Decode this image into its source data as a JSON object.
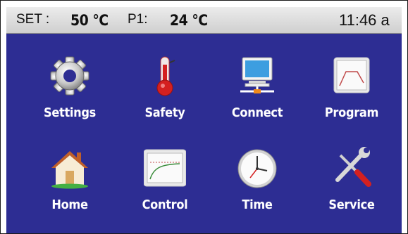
{
  "status": {
    "set_label": "SET :",
    "set_value": "50 °C",
    "p1_label": "P1:",
    "p1_value": "24 °C",
    "time": "11:46 a"
  },
  "menu": [
    {
      "label": "Settings",
      "icon": "gear-icon"
    },
    {
      "label": "Safety",
      "icon": "thermometer-icon"
    },
    {
      "label": "Connect",
      "icon": "network-computer-icon"
    },
    {
      "label": "Program",
      "icon": "program-graph-icon"
    },
    {
      "label": "Home",
      "icon": "house-icon"
    },
    {
      "label": "Control",
      "icon": "control-graph-icon"
    },
    {
      "label": "Time",
      "icon": "clock-icon"
    },
    {
      "label": "Service",
      "icon": "wrench-screwdriver-icon"
    }
  ],
  "colors": {
    "panel": "#2d2d93",
    "label": "#ffffff",
    "statusbar": "#dcdcdc"
  }
}
